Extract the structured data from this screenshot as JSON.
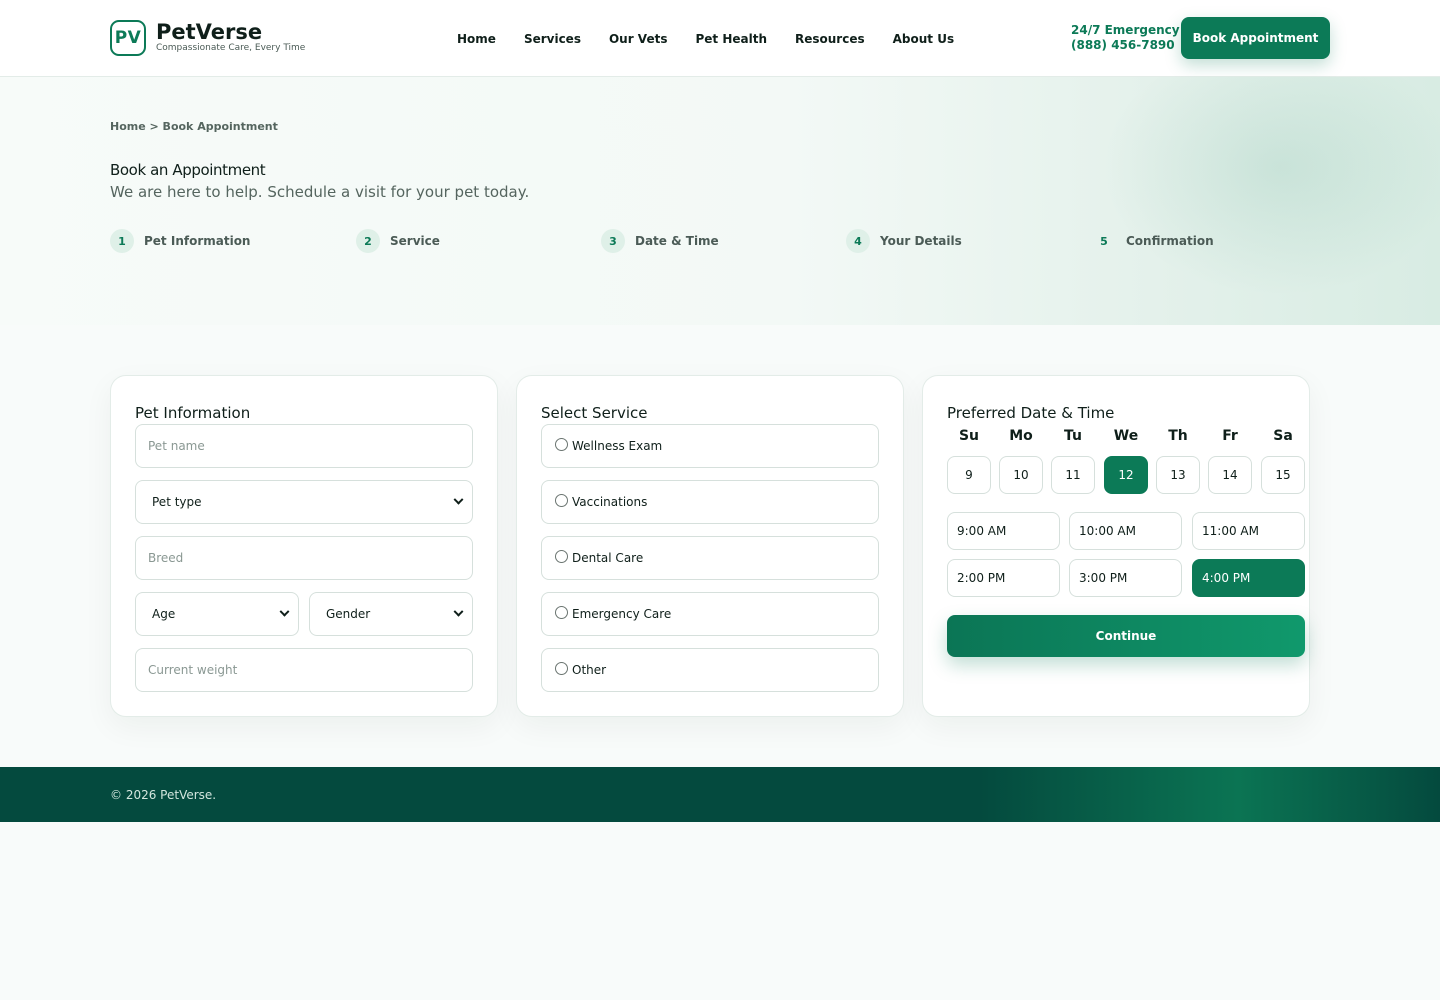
{
  "brand": {
    "logo_initials": "PV",
    "name": "PetVerse",
    "tagline": "Compassionate Care, Every Time"
  },
  "nav": {
    "items": [
      "Home",
      "Services",
      "Our Vets",
      "Pet Health",
      "Resources",
      "About Us"
    ]
  },
  "header": {
    "emergency_label": "24/7 Emergency",
    "emergency_phone": "(888) 456-7890",
    "book_button": "Book Appointment"
  },
  "hero": {
    "breadcrumb": "Home > Book Appointment",
    "title": "Book an Appointment",
    "subtitle": "We are here to help. Schedule a visit for your pet today.",
    "steps": [
      {
        "num": "1",
        "label": "Pet Information"
      },
      {
        "num": "2",
        "label": "Service"
      },
      {
        "num": "3",
        "label": "Date & Time"
      },
      {
        "num": "4",
        "label": "Your Details"
      },
      {
        "num": "5",
        "label": "Confirmation"
      }
    ]
  },
  "pet_info": {
    "title": "Pet Information",
    "pet_name_placeholder": "Pet name",
    "pet_type_value": "Pet type",
    "breed_placeholder": "Breed",
    "age_value": "Age",
    "gender_value": "Gender",
    "weight_placeholder": "Current weight"
  },
  "service": {
    "title": "Select Service",
    "options": [
      "Wellness Exam",
      "Vaccinations",
      "Dental Care",
      "Emergency Care",
      "Other"
    ]
  },
  "datetime": {
    "title": "Preferred Date & Time",
    "weekdays": [
      "Su",
      "Mo",
      "Tu",
      "We",
      "Th",
      "Fr",
      "Sa"
    ],
    "days": [
      "9",
      "10",
      "11",
      "12",
      "13",
      "14",
      "15"
    ],
    "selected_day": "12",
    "slots": [
      "9:00 AM",
      "10:00 AM",
      "11:00 AM",
      "2:00 PM",
      "3:00 PM",
      "4:00 PM"
    ],
    "selected_slot": "4:00 PM",
    "continue_button": "Continue"
  },
  "footer": {
    "copyright": "© 2026 PetVerse."
  },
  "colors": {
    "primary": "#0c7a57",
    "footer_bg": "#044a3e",
    "step_badge_bg": "#dff0e8"
  }
}
